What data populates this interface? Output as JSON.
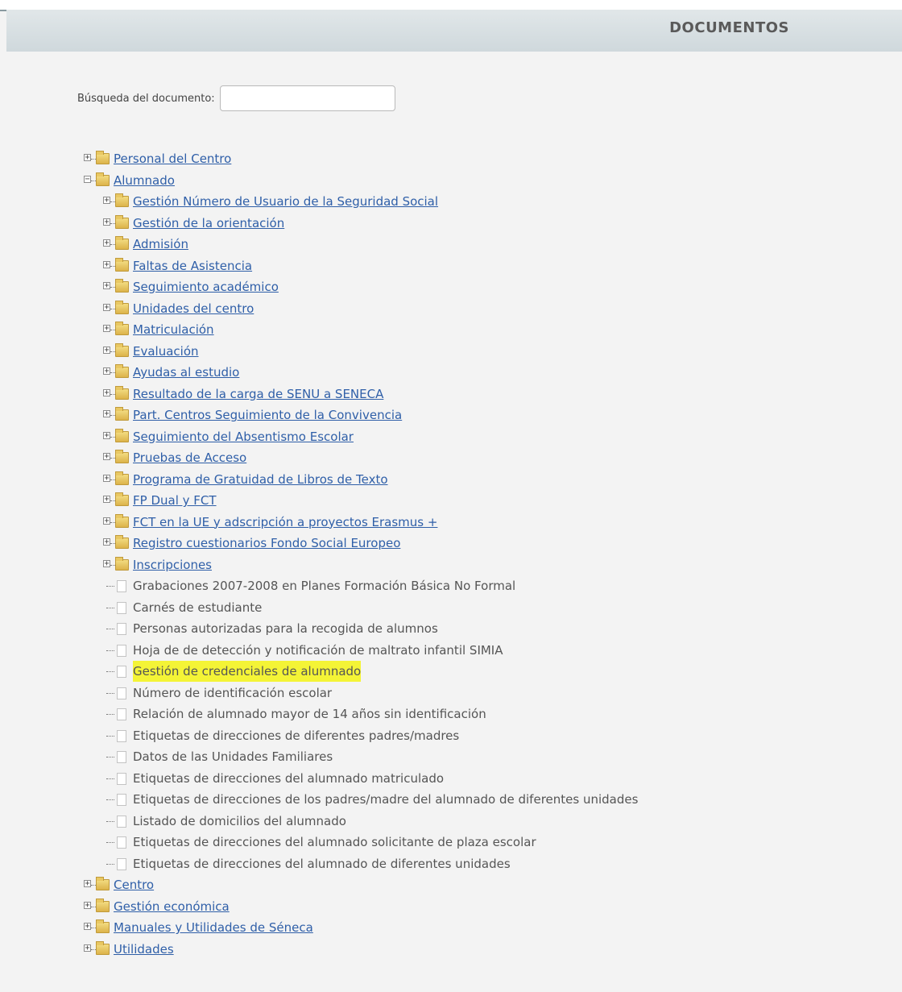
{
  "header": {
    "title": "DOCUMENTOS"
  },
  "search": {
    "label": "Búsqueda del documento:",
    "value": ""
  },
  "tree": {
    "root_before": [
      {
        "label": "Personal del Centro"
      }
    ],
    "alumnado": {
      "label": "Alumnado",
      "folders": [
        "Gestión Número de Usuario de la Seguridad Social",
        "Gestión de la orientación",
        "Admisión",
        "Faltas de Asistencia",
        "Seguimiento académico",
        "Unidades del centro",
        "Matriculación",
        "Evaluación",
        "Ayudas al estudio",
        "Resultado de la carga de SENU a SENECA",
        "Part. Centros Seguimiento de la Convivencia",
        "Seguimiento del Absentismo Escolar",
        "Pruebas de Acceso",
        "Programa de Gratuidad de Libros de Texto",
        "FP Dual y FCT",
        " FCT en la UE y adscripción a proyectos Erasmus +",
        "Registro cuestionarios Fondo Social Europeo",
        "Inscripciones"
      ],
      "documents": [
        "Grabaciones 2007-2008 en Planes Formación Básica No Formal",
        "Carnés de estudiante",
        "Personas autorizadas para la recogida de alumnos",
        "Hoja de de detección y notificación de maltrato infantil SIMIA",
        "Gestión de credenciales de alumnado",
        "Número de identificación escolar",
        "Relación de alumnado mayor de 14 años sin identificación",
        "Etiquetas de direcciones de diferentes padres/madres",
        "Datos de las Unidades Familiares",
        "Etiquetas de direcciones del alumnado matriculado",
        "Etiquetas de direcciones de los padres/madre del alumnado de diferentes unidades",
        "Listado de domicilios del alumnado",
        "Etiquetas de direcciones del alumnado solicitante de plaza escolar",
        "Etiquetas de direcciones del alumnado de diferentes unidades"
      ],
      "highlighted_document": "Gestión de credenciales de alumnado",
      "highlight_color": "#f4f436"
    },
    "root_after": [
      {
        "label": "Centro"
      },
      {
        "label": "Gestión económica"
      },
      {
        "label": "Manuales y Utilidades de Séneca"
      },
      {
        "label": "Utilidades"
      }
    ]
  },
  "colors": {
    "link": "#2f5fa8",
    "header_bg": "#cfd8dc",
    "page_bg": "#f3f3f3"
  }
}
